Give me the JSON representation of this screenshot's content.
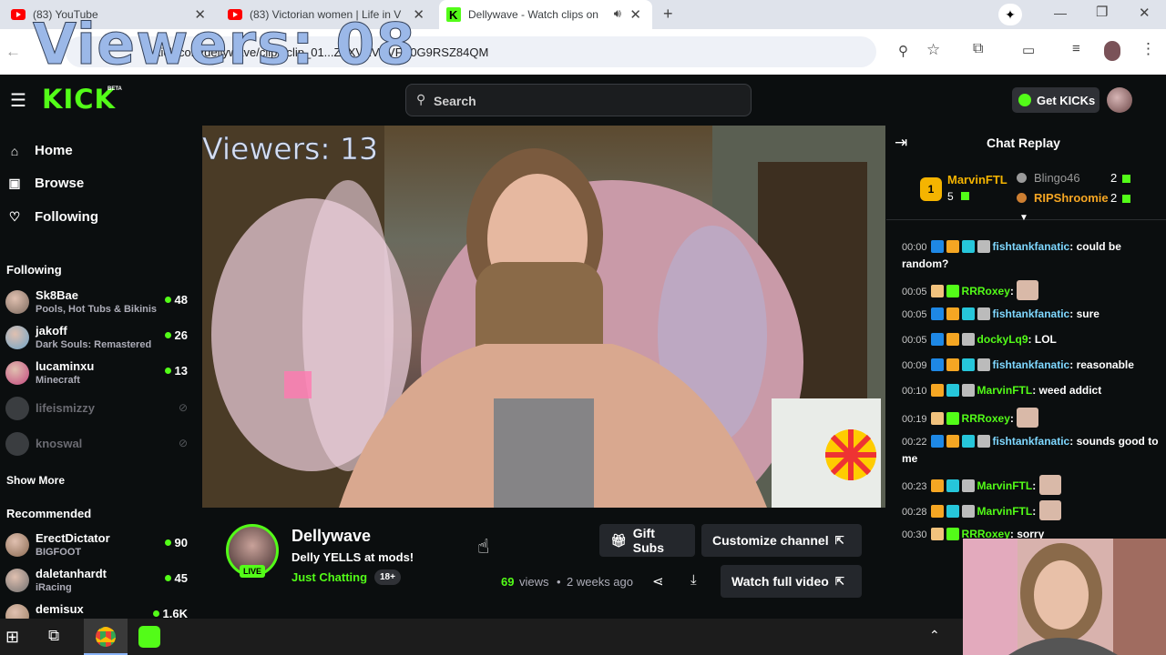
{
  "browser": {
    "tabs": [
      {
        "title": "(83) YouTube"
      },
      {
        "title": "(83) Victorian women | Life in V"
      },
      {
        "title": "Dellywave - Watch clips on"
      }
    ],
    "url": "kick.com/dellywave/clips/clip_01...Z3XVXVVVFV0G9RSZ84QM"
  },
  "overlay": {
    "viewers_text": "Viewers: 08"
  },
  "kick": {
    "logo": "KICK",
    "logo_badge": "BETA",
    "search_placeholder": "Search",
    "get_kicks": "Get KICKs"
  },
  "sidebar": {
    "nav": [
      {
        "label": "Home",
        "icon": "home-icon"
      },
      {
        "label": "Browse",
        "icon": "browse-icon"
      },
      {
        "label": "Following",
        "icon": "heart-icon"
      }
    ],
    "following_title": "Following",
    "following": [
      {
        "name": "Sk8Bae",
        "game": "Pools, Hot Tubs & Bikinis",
        "viewers": "48",
        "color": "#7c6a5e"
      },
      {
        "name": "jakoff",
        "game": "Dark Souls: Remastered",
        "viewers": "26",
        "color": "#6fa5c9"
      },
      {
        "name": "lucaminxu",
        "game": "Minecraft",
        "viewers": "13",
        "color": "#c4487f"
      },
      {
        "name": "lifeismizzy",
        "offline": true
      },
      {
        "name": "knoswal",
        "offline": true
      }
    ],
    "show_more": "Show More",
    "recommended_title": "Recommended",
    "recommended": [
      {
        "name": "ErectDictator",
        "game": "BIGFOOT",
        "viewers": "90",
        "color": "#8a6a52"
      },
      {
        "name": "daletanhardt",
        "game": "iRacing",
        "viewers": "45",
        "color": "#707070"
      },
      {
        "name": "demisux",
        "game": "",
        "viewers": "1.6K",
        "color": "#9c8065"
      }
    ]
  },
  "video": {
    "viewers_text": "Viewers: 13"
  },
  "channel": {
    "name": "Dellywave",
    "clip_title": "Delly YELLS at mods!",
    "category": "Just Chatting",
    "rating": "18+",
    "live": "LIVE",
    "views_count": "69",
    "views_label": "views",
    "age": "2 weeks ago",
    "gift_subs": "Gift Subs",
    "customize": "Customize channel",
    "watch_full": "Watch full video"
  },
  "chat": {
    "title": "Chat Replay",
    "leaderboard": {
      "first": {
        "rank": "1",
        "name": "MarvinFTL",
        "count": "5"
      },
      "others": [
        {
          "name": "Blingo46",
          "count": "2"
        },
        {
          "name": "RIPShroomie",
          "count": "2"
        }
      ]
    },
    "messages": [
      {
        "time": "00:00",
        "user": "fishtankfanatic",
        "text": "could be random?",
        "badges": [
          "#1e88e5",
          "#f5a623",
          "#26c6da",
          "#bbbbbb"
        ],
        "ucls": "u2"
      },
      {
        "time": "00:05",
        "user": "RRRoxey",
        "text": "",
        "badges": [
          "#f1c27d",
          "#53fc18"
        ],
        "ucls": "u",
        "emote": true
      },
      {
        "time": "00:05",
        "user": "fishtankfanatic",
        "text": "sure",
        "badges": [
          "#1e88e5",
          "#f5a623",
          "#26c6da",
          "#bbbbbb"
        ],
        "ucls": "u2"
      },
      {
        "time": "00:05",
        "user": "dockyLq9",
        "text": "LOL",
        "badges": [
          "#1e88e5",
          "#f5a623",
          "#bbbbbb"
        ],
        "ucls": "u"
      },
      {
        "time": "00:09",
        "user": "fishtankfanatic",
        "text": "reasonable",
        "badges": [
          "#1e88e5",
          "#f5a623",
          "#26c6da",
          "#bbbbbb"
        ],
        "ucls": "u2"
      },
      {
        "time": "00:10",
        "user": "MarvinFTL",
        "text": "weed addict",
        "badges": [
          "#f5a623",
          "#26c6da",
          "#bbbbbb"
        ],
        "ucls": "u"
      },
      {
        "time": "00:19",
        "user": "RRRoxey",
        "text": "",
        "badges": [
          "#f1c27d",
          "#53fc18"
        ],
        "ucls": "u",
        "emote": true
      },
      {
        "time": "00:22",
        "user": "fishtankfanatic",
        "text": "sounds good to me",
        "badges": [
          "#1e88e5",
          "#f5a623",
          "#26c6da",
          "#bbbbbb"
        ],
        "ucls": "u2"
      },
      {
        "time": "00:23",
        "user": "MarvinFTL",
        "text": "",
        "badges": [
          "#f5a623",
          "#26c6da",
          "#bbbbbb"
        ],
        "ucls": "u",
        "emote": true
      },
      {
        "time": "00:28",
        "user": "MarvinFTL",
        "text": "",
        "badges": [
          "#f5a623",
          "#26c6da",
          "#bbbbbb"
        ],
        "ucls": "u",
        "emote": true
      },
      {
        "time": "00:30",
        "user": "RRRoxey",
        "text": "sorry",
        "badges": [
          "#f1c27d",
          "#53fc18"
        ],
        "ucls": "u"
      }
    ]
  }
}
